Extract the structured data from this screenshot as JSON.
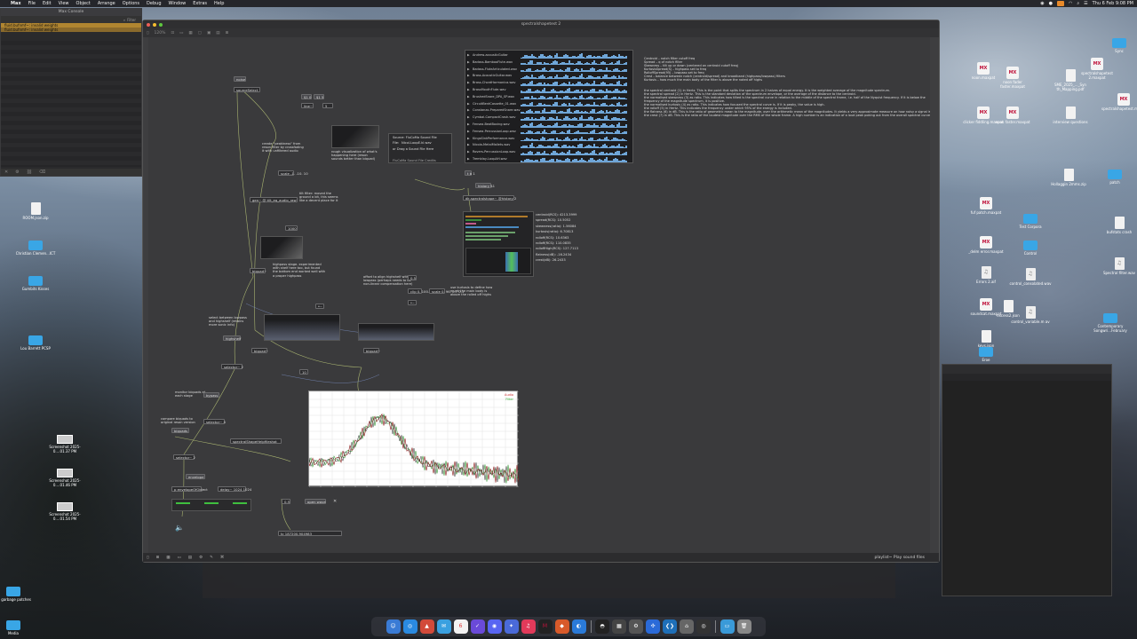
{
  "menubar": {
    "app_name": "Max",
    "items": [
      "File",
      "Edit",
      "View",
      "Object",
      "Arrange",
      "Options",
      "Debug",
      "Window",
      "Extras",
      "Help"
    ],
    "clock": "Thu 6 Feb 9:08 PM"
  },
  "console": {
    "title": "Max Console",
    "search_placeholder": "Filter",
    "rows": [
      "fluid.bufnmf~: invalid weights",
      "fluid.bufnmf~: invalid weights"
    ]
  },
  "patcher": {
    "title": "spectralshapetest 2",
    "zoom": "120%",
    "status_hint": "playlist~ Play sound files"
  },
  "playlist_items": [
    "Andrew-acousticGuitar",
    "Badass-BambooFlute.wav",
    "Badass-FluteArticulated.wav",
    "Brass-AcousticGuitar.wav",
    "Brass-ChordHarmonica.wav",
    "BrassMouthFlute.wav",
    "BrushedSnare_DPA_SP.wav",
    "CircuitBentCassette_01.wav",
    "Constanzo-PreparedSnare.wav",
    "Cymbal-CompactCrash.wav",
    "Fensea-BeatBoxing.wav",
    "Fensea-PercussionLoop.wav",
    "KingsSinkPerformance.wav",
    "Nicola-MetalMallets.wav",
    "Rovers-PercussionLoop.wav",
    "Tremblay-LoopAH.wav"
  ],
  "description": {
    "lines": [
      "Centroid – notch filter cutoff freq",
      "Spread – q of notch filter",
      "Skewness – tilt up or down (centered on centroid cutoff freq)",
      "KurtosisSpread(S) – highpass set to freq",
      "RolloffSpread(95) – lowpass set to freq",
      "Crest – balance between notch (centroid/spread) and broadband (highpass/lowpass) filters",
      "Kurtosis – how much the main body of the filter is above the noted off highs"
    ],
    "paragraphs": [
      "the spectral centroid (1) in Hertz. This is the point that splits the spectrum in 2 halves of equal energy. It is the weighted average of the magnitude spectrum.",
      "the spectral spread (2) in Hertz. This is the standard deviation of the spectrum envelope, or the average of the distance to the centroid.",
      "the normalised skewness (3) as ratio. This indicates how tilted is the spectral curve in relation to the middle of the spectral frame, i.e. half of the Nyquist frequency. If it is below the frequency of the magnitude spectrum, it is positive.",
      "the normalised kurtosis (4) as ratio. This indicates how focused the spectral curve is. If it is peaky, the value is high.",
      "the rolloff (5) in Hertz. This indicates the frequency under which 95% of the energy is included.",
      "the flatness (6) in dB. This is the ratio of geometric mean to the magnitude, over the arithmetic mean of the magnitudes. It yields a very approximate measure on how noisy a signal is.",
      "the crest (7) in dB. This is the ratio of the loudest magnitude over the RMS of the whole frame. A high number is an indication of a loud peak poking out from the overall spectral curve."
    ]
  },
  "objects": {
    "noise": "noise",
    "source_select": "sourceSelect",
    "val1": "$1 0",
    "val2": "$1 5",
    "line_obj": "line~",
    "num_5": "5",
    "create_peaks_comment": "create \"peakiness\" from reson filter by crossfading it with unfiltered audio",
    "rough_viz_comment": "rough visualization of what's happening here (reson sounds better than biquad)",
    "source_label": "Source: FluCoMa Sound File",
    "file_label": "File:",
    "file_value": "Nicol-LoopE.kl.wav",
    "drag_hint": "or Drag a Sound File Here",
    "sound_file_credit": "FluCoMa Sound File Credits",
    "scale_1": "scale -1. -10. 10",
    "tilt_comment": "tilt filter: moved the ground a bit, this seems like a decent place for it",
    "gen_obj": "gen~ @ tilt_eq_audio_raw",
    "num_1000": "1000",
    "highpass_comment": "highpass stage. experimented with shelf here too, but found the bottom end worked well with a proper highpass",
    "biquad1": "biquad~",
    "mul1": "*~",
    "offset_comment": "offset to align highshelf with lowpass (perhaps needs to be non-linear compensation here)",
    "num_05": "0.5",
    "clip_obj": "clip 0. 100.",
    "scale_2": "scale 0. 96. 0.7 0.1",
    "use_kurtosis_comment": "use kurtosis to define how much the main body is above the rolled off highs",
    "mul2": "*~",
    "biquad2": "biquad~",
    "select_comment": "select between lowpass and highshelf (retains more sonic info)",
    "highshelf": "highshelf",
    "selector_1": "selector~ 2",
    "num_10": "10",
    "monitor_comment": "monitor biquads at each stage",
    "bypass": "bypass",
    "selector_2": "selector~ 4",
    "compare_comment": "compare biquads to original reson version",
    "biquads_toggle": "biquads",
    "spectral_shape_obj": "spectralShapeHelpfileshot",
    "selector_3": "selector~ 2",
    "envelope": "envelope",
    "envelope_obj": "p envelopeOfObject",
    "delay_obj": "delay~ 1024 1024",
    "thresh": "0.5",
    "open_wave": "open wave",
    "bang_obj": "t b 1",
    "history": "history $1",
    "dk_obj": "dk.spectralshape~ @history 2",
    "result_val": "tc 187200.904983"
  },
  "readouts": [
    "centroid(RCS): 4213.3999",
    "spread(RCS): 10.5052",
    "skewness(ratio): 1.56084",
    "kurtosis(ratio): 6.70813",
    "rolloff(RCS): 10.6363",
    "rolloff(RCS): 110.0835",
    "rolloffHigh(RCS): 127.7113",
    "flatness(dB): -16.2434",
    "crest(dB): 26.2433"
  ],
  "spectrum_labels": [
    "Audio",
    "Filter"
  ],
  "desktop_icons": [
    {
      "label": "Sync",
      "type": "folder"
    },
    {
      "label": "spectralshapetest 2.maxpat",
      "type": "max"
    },
    {
      "label": "noon.maxpat",
      "type": "max"
    },
    {
      "label": "noon fader faster.maxpat",
      "type": "max"
    },
    {
      "label": "SME_2025_..._Syn th_Mapping.pdf",
      "type": "doc"
    },
    {
      "label": "spectralshapetest.maxpat",
      "type": "max"
    },
    {
      "label": "clicker fiddling.maxpat",
      "type": "max"
    },
    {
      "label": "noon faster.maxpat",
      "type": "max"
    },
    {
      "label": "interview questions",
      "type": "doc"
    },
    {
      "label": "patch",
      "type": "folder"
    },
    {
      "label": "Hollaggin 2mms.zip",
      "type": "doc"
    },
    {
      "label": "fuf patch.maxpat",
      "type": "max"
    },
    {
      "label": "Test Corpora",
      "type": "folder"
    },
    {
      "label": "bufstats crash",
      "type": "doc"
    },
    {
      "label": "_delm error.maxpat",
      "type": "max"
    },
    {
      "label": "Control",
      "type": "folder"
    },
    {
      "label": "Spectral filter.wav",
      "type": "audio"
    },
    {
      "label": "Errors 2.aif",
      "type": "audio"
    },
    {
      "label": "control_consolated.wav",
      "type": "audio"
    },
    {
      "label": "soundcat.maxpat",
      "type": "max"
    },
    {
      "label": "excess2.json",
      "type": "doc"
    },
    {
      "label": "control_variable.m av",
      "type": "audio"
    },
    {
      "label": "Contemporary Songwri...February",
      "type": "folder"
    },
    {
      "label": "keys.json",
      "type": "doc"
    },
    {
      "label": "Eroe",
      "type": "folder"
    },
    {
      "label": "ROOM.json.zip",
      "type": "doc"
    },
    {
      "label": "Christian Clemen...ICT",
      "type": "folder"
    },
    {
      "label": "Gumbits Kisses",
      "type": "folder"
    },
    {
      "label": "Lou Barrett PCSP",
      "type": "folder"
    },
    {
      "label": "Screenshot 2025-0....01.37 PM",
      "type": "shot"
    },
    {
      "label": "Screenshot 2025-0....01.46 PM",
      "type": "shot"
    },
    {
      "label": "Screenshot 2025-0....01.54 PM",
      "type": "shot"
    },
    {
      "label": "dk garbage patches",
      "type": "folder"
    },
    {
      "label": "Media",
      "type": "folder"
    }
  ],
  "colors": {
    "accent": "#b08530",
    "cable": "#bcc97a",
    "spectrum_green": "#3a9a3a",
    "spectrum_red": "#8a1a1a"
  }
}
